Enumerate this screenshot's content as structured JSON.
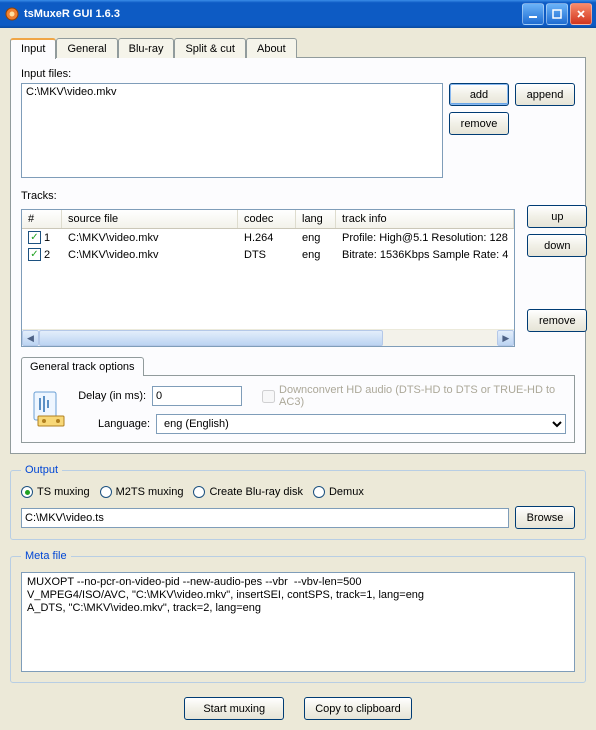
{
  "window": {
    "title": "tsMuxeR GUI 1.6.3"
  },
  "tabs": [
    "Input",
    "General",
    "Blu-ray",
    "Split & cut",
    "About"
  ],
  "input_files": {
    "label": "Input files:",
    "content": "C:\\MKV\\video.mkv",
    "add": "add",
    "append": "append",
    "remove": "remove"
  },
  "tracks": {
    "label": "Tracks:",
    "headers": {
      "num": "#",
      "source": "source file",
      "codec": "codec",
      "lang": "lang",
      "info": "track info"
    },
    "rows": [
      {
        "checked": true,
        "num": "1",
        "source": "C:\\MKV\\video.mkv",
        "codec": "H.264",
        "lang": "eng",
        "info": "Profile: High@5.1  Resolution: 128"
      },
      {
        "checked": true,
        "num": "2",
        "source": "C:\\MKV\\video.mkv",
        "codec": "DTS",
        "lang": "eng",
        "info": "Bitrate: 1536Kbps  Sample Rate: 4"
      }
    ],
    "up": "up",
    "down": "down",
    "remove": "remove"
  },
  "gto": {
    "tab": "General track options",
    "delay_label": "Delay (in ms):",
    "delay_value": "0",
    "downconvert_label": "Downconvert HD audio (DTS-HD to DTS or TRUE-HD to AC3)",
    "language_label": "Language:",
    "language_value": "eng (English)"
  },
  "output": {
    "legend": "Output",
    "radios": [
      "TS muxing",
      "M2TS muxing",
      "Create Blu-ray disk",
      "Demux"
    ],
    "selected": 0,
    "path": "C:\\MKV\\video.ts",
    "browse": "Browse"
  },
  "meta": {
    "legend": "Meta file",
    "content": "MUXOPT --no-pcr-on-video-pid --new-audio-pes --vbr  --vbv-len=500\nV_MPEG4/ISO/AVC, \"C:\\MKV\\video.mkv\", insertSEI, contSPS, track=1, lang=eng\nA_DTS, \"C:\\MKV\\video.mkv\", track=2, lang=eng"
  },
  "bottom": {
    "start": "Start muxing",
    "copy": "Copy to clipboard"
  }
}
